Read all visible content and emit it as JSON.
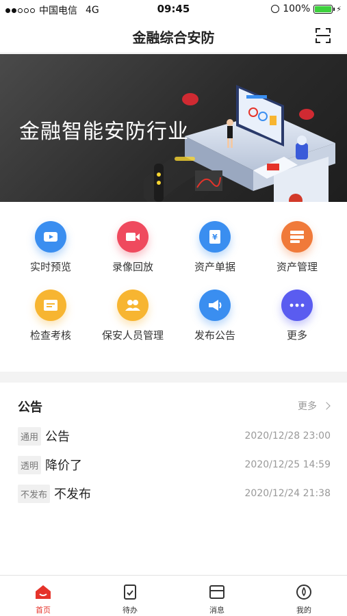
{
  "status": {
    "carrier": "中国电信",
    "network": "4G",
    "time": "09:45",
    "battery": "100%",
    "battery_level": 1.0
  },
  "header": {
    "title": "金融综合安防",
    "scan_icon": "scan-icon"
  },
  "banner": {
    "text": "金融智能安防行业"
  },
  "grid": [
    {
      "label": "实时预览",
      "icon": "video-preview-icon",
      "color": "#3a8ef0"
    },
    {
      "label": "录像回放",
      "icon": "video-playback-icon",
      "color": "#ef4a5e"
    },
    {
      "label": "资产单据",
      "icon": "asset-document-icon",
      "color": "#3a8ef0"
    },
    {
      "label": "资产管理",
      "icon": "asset-management-icon",
      "color": "#f07a3a"
    },
    {
      "label": "检查考核",
      "icon": "inspection-icon",
      "color": "#f7b531"
    },
    {
      "label": "保安人员管理",
      "icon": "security-staff-icon",
      "color": "#f7b531"
    },
    {
      "label": "发布公告",
      "icon": "announcement-icon",
      "color": "#3a8ef0"
    },
    {
      "label": "更多",
      "icon": "more-icon",
      "color": "#5a5cf0"
    }
  ],
  "notice": {
    "title": "公告",
    "more": "更多",
    "items": [
      {
        "tag": "通用",
        "title": "公告",
        "time": "2020/12/28 23:00"
      },
      {
        "tag": "透明",
        "title": "降价了",
        "time": "2020/12/25 14:59"
      },
      {
        "tag": "不发布",
        "title": "不发布",
        "time": "2020/12/24 21:38"
      }
    ]
  },
  "tabs": [
    {
      "label": "首页",
      "icon": "home-icon",
      "active": true
    },
    {
      "label": "待办",
      "icon": "todo-icon",
      "active": false
    },
    {
      "label": "消息",
      "icon": "message-icon",
      "active": false
    },
    {
      "label": "我的",
      "icon": "profile-icon",
      "active": false
    }
  ],
  "colors": {
    "accent": "#e5332a",
    "battery": "#3dd13d"
  }
}
